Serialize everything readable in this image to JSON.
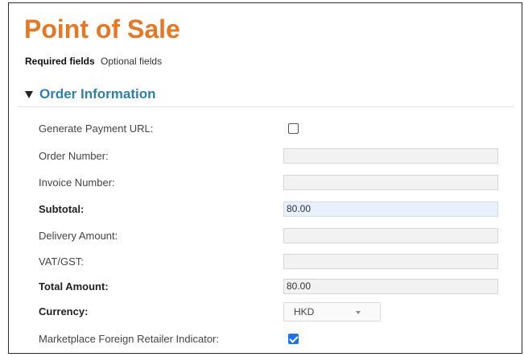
{
  "page": {
    "title": "Point of Sale"
  },
  "field_tabs": {
    "required_label": "Required fields",
    "optional_label": "Optional fields"
  },
  "section": {
    "title": "Order Information",
    "expanded": true
  },
  "form": {
    "generate_payment_url": {
      "label": "Generate Payment URL:",
      "checked": false
    },
    "order_number": {
      "label": "Order Number:",
      "value": ""
    },
    "invoice_number": {
      "label": "Invoice Number:",
      "value": ""
    },
    "subtotal": {
      "label": "Subtotal:",
      "value": "80.00"
    },
    "delivery_amount": {
      "label": "Delivery Amount:",
      "value": ""
    },
    "vat_gst": {
      "label": "VAT/GST:",
      "value": ""
    },
    "total_amount": {
      "label": "Total Amount:",
      "value": "80.00"
    },
    "currency": {
      "label": "Currency:",
      "selected": "HKD"
    },
    "marketplace_indicator": {
      "label": "Marketplace Foreign Retailer Indicator:",
      "checked": true
    }
  },
  "colors": {
    "title": "#e87722",
    "section_title": "#2f7fa8",
    "checkbox_checked": "#1a73e8",
    "highlight_field": "#e8f0fb"
  },
  "icons": {
    "section_toggle": "triangle-down-icon",
    "select_arrow": "chevron-down-icon",
    "check": "check-icon"
  }
}
